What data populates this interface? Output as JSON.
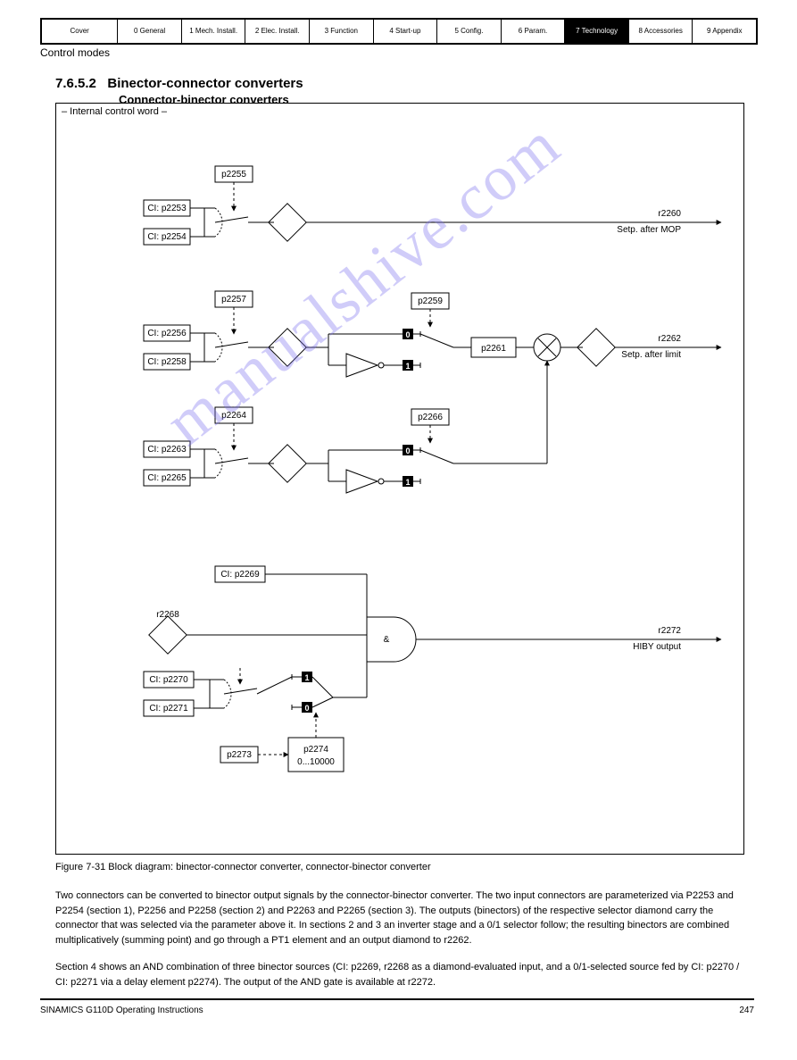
{
  "header": {
    "cells": [
      "Cover",
      "0 General",
      "1 Mech. Install.",
      "2 Elec. Install.",
      "3 Function",
      "4 Start-up",
      "5 Config.",
      "6 Param.",
      "7 Technology",
      "8 Accessories",
      "9 Appendix"
    ],
    "active_index": 8
  },
  "page_title": "Control modes",
  "section_number": "7.6.5.2",
  "section_title_1": "Binector-connector converters",
  "section_title_2": "Connector-binector converters",
  "diagram": {
    "title": "– Internal control word –",
    "groups": [
      {
        "sel": "p2255",
        "in1": "CI: p2253",
        "in2": "CI: p2254",
        "out": "r2260",
        "out_label": "Setp. after MOP"
      },
      {
        "sel": "p2257",
        "in1": "CI: p2256",
        "in2": "CI: p2258",
        "inv": "p2259",
        "pt1": "p2261",
        "out": "r2262",
        "out_label": "Setp. after limit"
      },
      {
        "sel": "p2264",
        "in1": "CI: p2263",
        "in2": "CI: p2265",
        "inv": "p2266"
      },
      {
        "top_src": "CI: p2269",
        "and_out": "r2272",
        "and_out_label": "HIBY output",
        "src_a": "CI: p2270",
        "src_b": "CI: p2271",
        "sel2": "p2273",
        "delay_label": "p2274",
        "delay_hint": "0...10000",
        "diamond_in": "r2268"
      }
    ],
    "chips": {
      "zero": "0",
      "one": "1"
    }
  },
  "figure_caption": "Figure 7-31  Block diagram: binector-connector converter, connector-binector converter",
  "body": {
    "p1": "Two connectors can be converted to binector output signals by the connector-binector converter. The two input connectors are parameterized via P2253 and P2254 (section 1), P2256 and P2258 (section 2) and P2263 and P2265 (section 3). The outputs (binectors) of the respective selector diamond carry the connector that was selected via the parameter above it. In sections 2 and 3 an inverter stage and a 0/1 selector follow; the resulting binectors are combined multiplicatively (summing point) and go through a PT1 element and an output diamond to r2262.",
    "p2": "Section 4 shows an AND combination of three binector sources (CI: p2269, r2268 as a diamond-evaluated input, and a 0/1-selected source fed by CI: p2270 / CI: p2271 via a delay element p2274). The output of the AND gate is available at r2272."
  },
  "footer": {
    "left": "SINAMICS G110D Operating Instructions",
    "right": "247"
  },
  "watermark": "manualshive.com"
}
